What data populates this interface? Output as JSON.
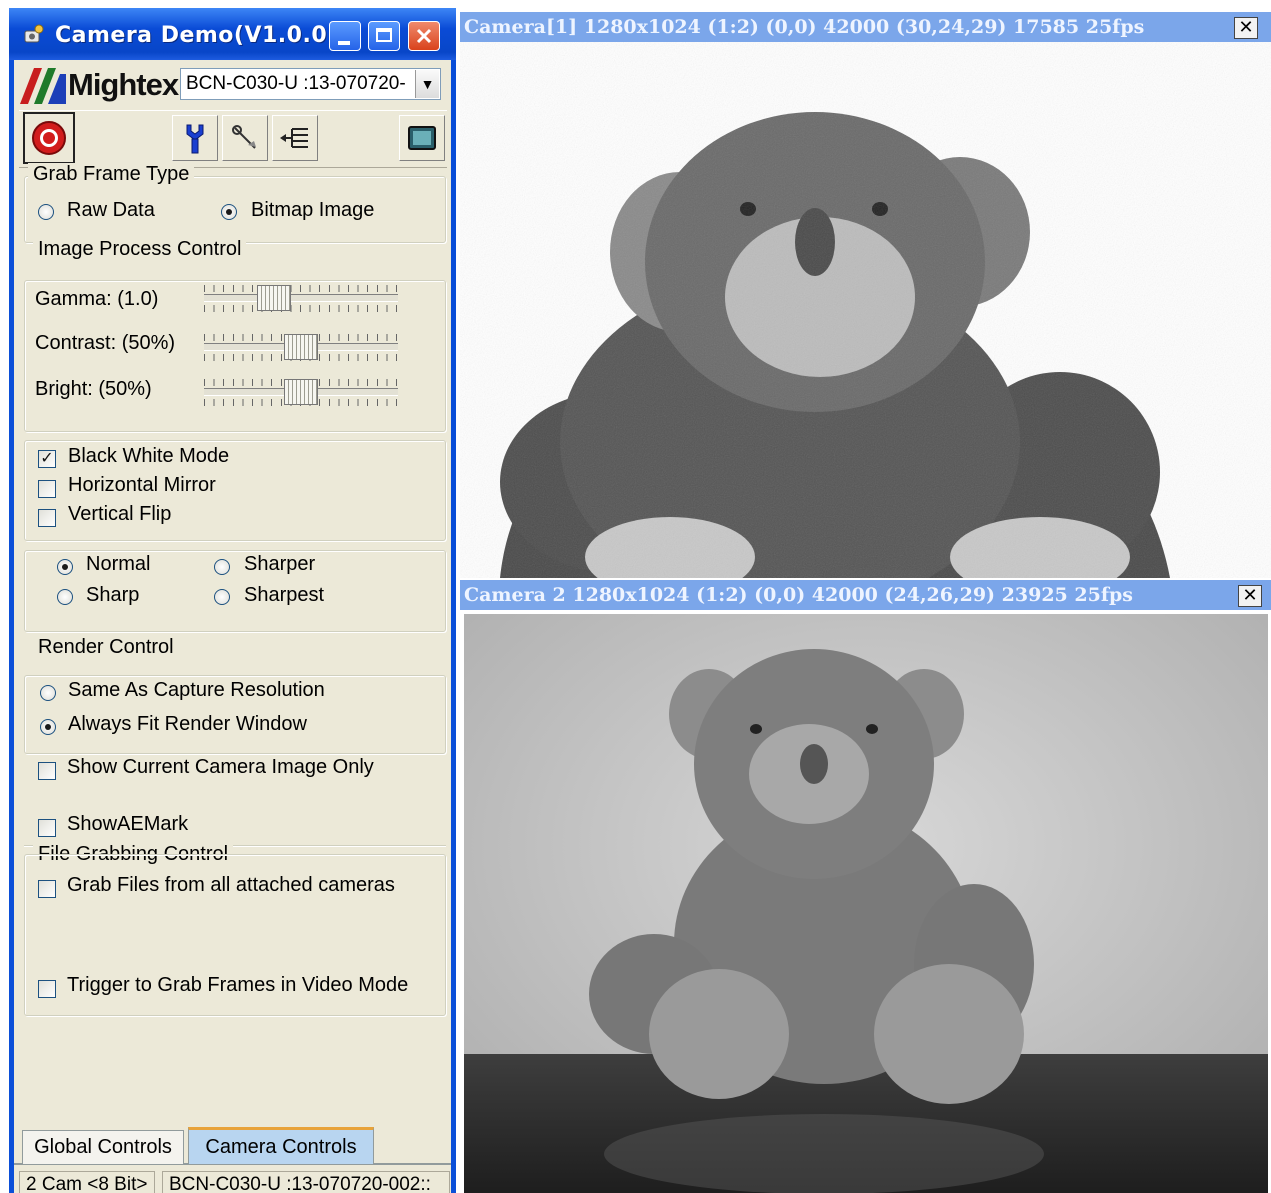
{
  "window": {
    "title": "Camera Demo(V1.0.0)",
    "buttons": [
      "minimize",
      "maximize",
      "close"
    ]
  },
  "header": {
    "brand": "Mightex",
    "device_select": "BCN-C030-U   :13-070720-"
  },
  "toolbar": {
    "icons": [
      "record-icon",
      "properties-icon",
      "tools-icon",
      "tree-icon",
      "display-icon"
    ]
  },
  "grab_frame": {
    "title": "Grab Frame Type",
    "raw": "Raw Data",
    "bitmap": "Bitmap Image",
    "selected": "bitmap"
  },
  "image_process": {
    "title": "Image Process Control",
    "sliders": [
      {
        "label": "Gamma: (1.0)",
        "position": 0.36
      },
      {
        "label": "Contrast: (50%)",
        "position": 0.5
      },
      {
        "label": "Bright: (50%)",
        "position": 0.5
      }
    ]
  },
  "modes": {
    "bw": {
      "label": "Black White Mode",
      "checked": true
    },
    "hmirror": {
      "label": "Horizontal Mirror",
      "checked": false
    },
    "vflip": {
      "label": "Vertical Flip",
      "checked": false
    }
  },
  "sharpness": {
    "normal": "Normal",
    "sharper": "Sharper",
    "sharp": "Sharp",
    "sharpest": "Sharpest",
    "selected": "normal"
  },
  "render": {
    "title": "Render Control",
    "same": "Same As Capture Resolution",
    "fit": "Always Fit Render Window",
    "selected": "fit",
    "current_only": "Show Current Camera Image Only",
    "aemark": "ShowAEMark"
  },
  "file_grab": {
    "title": "File Grabbing Control",
    "all_cameras": "Grab Files from all attached cameras",
    "trigger": "Trigger to Grab Frames in Video Mode"
  },
  "tabs": {
    "global": "Global Controls",
    "camera": "Camera Controls",
    "active": "camera"
  },
  "status": {
    "cams": "2 Cam <8 Bit>",
    "device": "BCN-C030-U   :13-070720-002::"
  },
  "cameras": [
    {
      "title": "Camera[1]   1280x1024 (1:2) (0,0) 42000 (30,24,29) 17585 25fps",
      "close": "✕"
    },
    {
      "title": "Camera 2   1280x1024 (1:2) (0,0) 42000 (24,26,29) 23925 25fps",
      "close": "✕"
    }
  ],
  "colors": {
    "title_bar": "#0b4fd8",
    "panel": "#ece9d8",
    "cam_title": "#7ba6ea",
    "tab_active": "#b8d5f0"
  }
}
